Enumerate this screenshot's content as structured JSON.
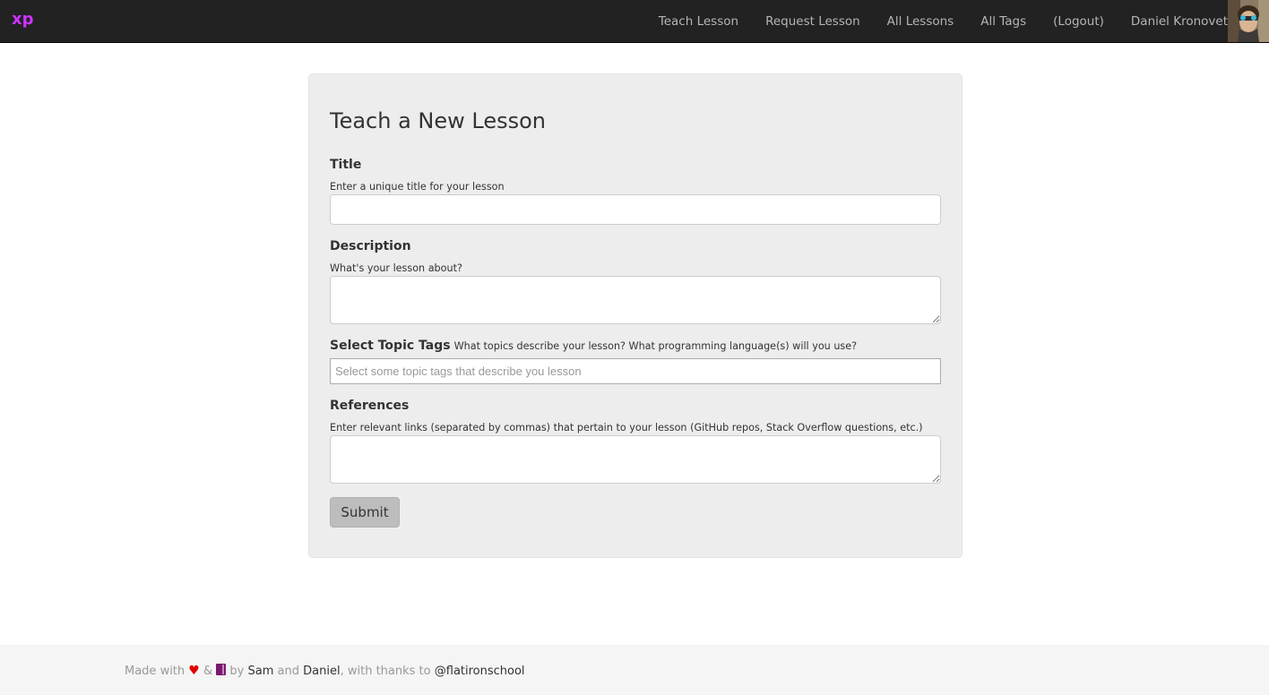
{
  "nav": {
    "brand": "xp",
    "links": [
      "Teach Lesson",
      "Request Lesson",
      "All Lessons",
      "All Tags",
      "(Logout)",
      "Daniel Kronovet"
    ]
  },
  "form": {
    "title": "Teach a New Lesson",
    "title_label": "Title",
    "title_help": "Enter a unique title for your lesson",
    "title_value": "",
    "description_label": "Description",
    "description_help": "What's your lesson about?",
    "description_value": "",
    "tags_label": "Select Topic Tags",
    "tags_help": "What topics describe your lesson? What programming language(s) will you use?",
    "tags_placeholder": "Select some topic tags that describe you lesson",
    "references_label": "References",
    "references_help": "Enter relevant links (separated by commas) that pertain to your lesson (GitHub repos, Stack Overflow questions, etc.)",
    "references_value": "",
    "submit_label": "Submit"
  },
  "footer": {
    "made_with": "Made with",
    "amp": "&",
    "by": "by",
    "author1": "Sam",
    "and": "and",
    "author2": "Daniel",
    "thanks": ", with thanks to",
    "org": "@flatironschool"
  },
  "colors": {
    "brand": "#cc33ff",
    "navbar": "#222222",
    "panel": "#ededed",
    "heart": "#e30000",
    "book": "#7a1a6e"
  },
  "icons": {
    "heart": "heart-icon",
    "book": "book-icon"
  }
}
